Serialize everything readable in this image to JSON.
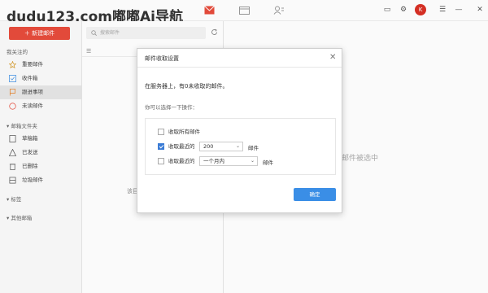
{
  "brand": "dudu123.com嘟嘟Ai导航",
  "user": {
    "avatar_letter": "K"
  },
  "sidebar": {
    "compose_label": "＋ 新建邮件",
    "favorites_title": "我关注的",
    "favorites": [
      {
        "label": "重要邮件",
        "icon": "star-icon"
      },
      {
        "label": "收件箱",
        "icon": "inbox-icon"
      },
      {
        "label": "跟进事项",
        "icon": "flag-icon",
        "active": true
      },
      {
        "label": "未读邮件",
        "icon": "unread-icon"
      }
    ],
    "folders_title": "邮箱文件夹",
    "folders": [
      {
        "label": "草稿箱",
        "icon": "draft-icon"
      },
      {
        "label": "已发送",
        "icon": "sent-icon"
      },
      {
        "label": "已删除",
        "icon": "trash-icon"
      },
      {
        "label": "垃圾邮件",
        "icon": "spam-icon"
      }
    ],
    "tags_title": "标签",
    "other_title": "其他邮箱"
  },
  "list": {
    "search_placeholder": "搜索邮件",
    "empty_text": "该目"
  },
  "reader": {
    "hint": "邮件被选中"
  },
  "dialog": {
    "title": "邮件收取设置",
    "message": "在服务器上，有0未收取的邮件。",
    "subtitle": "你可以选择一下操作：",
    "options": [
      {
        "label": "收取所有邮件",
        "checked": false
      },
      {
        "label": "收取最近的",
        "checked": true,
        "select_value": "200",
        "unit": "邮件"
      },
      {
        "label": "收取最近的",
        "checked": false,
        "select_value": "一个月内",
        "unit": "邮件"
      }
    ],
    "ok_label": "确定"
  },
  "colors": {
    "accent": "#e74c3c",
    "primary": "#3a8ee6"
  }
}
